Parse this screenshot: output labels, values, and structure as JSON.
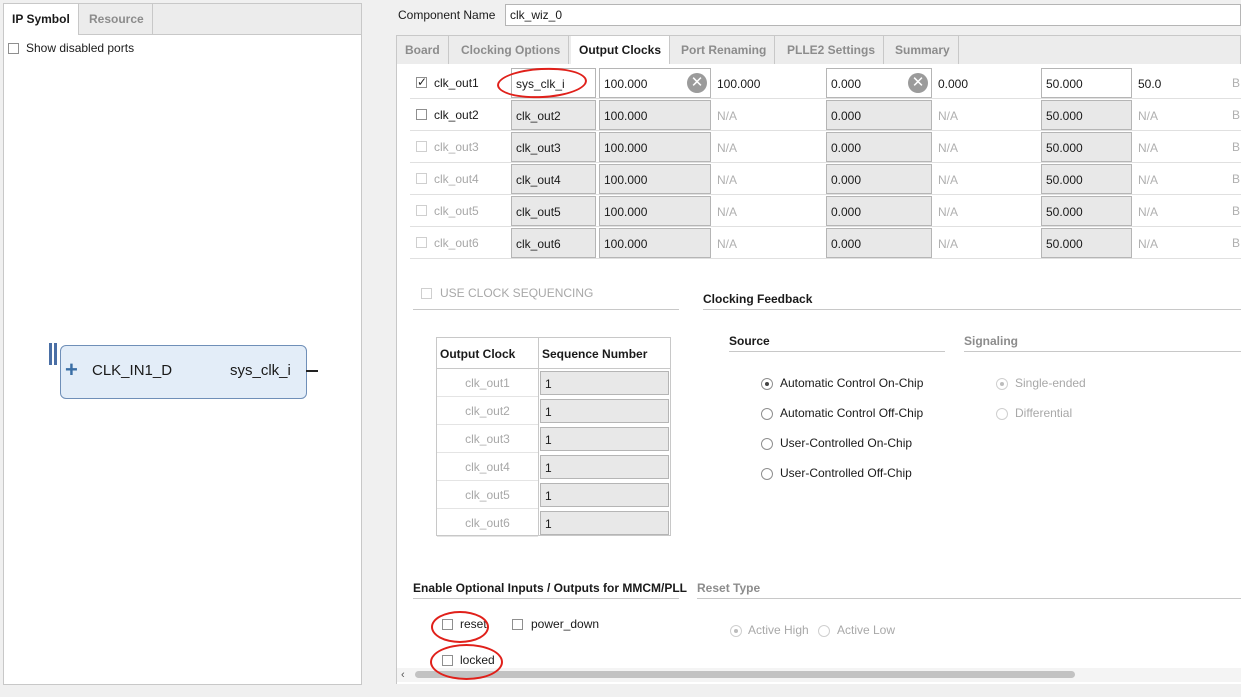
{
  "left_panel": {
    "tabs": [
      "IP Symbol",
      "Resource"
    ],
    "show_disabled_ports": "Show disabled ports",
    "symbol": {
      "input_port": "CLK_IN1_D",
      "output_port": "sys_clk_i"
    }
  },
  "component": {
    "label": "Component Name",
    "value": "clk_wiz_0"
  },
  "tabs": [
    "Board",
    "Clocking Options",
    "Output Clocks",
    "Port Renaming",
    "PLLE2 Settings",
    "Summary"
  ],
  "active_tab": "Output Clocks",
  "output_clocks": [
    {
      "name": "clk_out1",
      "port": "sys_clk_i",
      "freq": "100.000",
      "actual_freq": "100.000",
      "phase": "0.000",
      "actual_phase": "0.000",
      "duty": "50.000",
      "actual_duty": "50.0",
      "buffer": "B",
      "checked": true,
      "enabled": true
    },
    {
      "name": "clk_out2",
      "port": "clk_out2",
      "freq": "100.000",
      "actual_freq": "N/A",
      "phase": "0.000",
      "actual_phase": "N/A",
      "duty": "50.000",
      "actual_duty": "N/A",
      "buffer": "B",
      "checked": false,
      "enabled": true
    },
    {
      "name": "clk_out3",
      "port": "clk_out3",
      "freq": "100.000",
      "actual_freq": "N/A",
      "phase": "0.000",
      "actual_phase": "N/A",
      "duty": "50.000",
      "actual_duty": "N/A",
      "buffer": "B",
      "checked": false,
      "enabled": false
    },
    {
      "name": "clk_out4",
      "port": "clk_out4",
      "freq": "100.000",
      "actual_freq": "N/A",
      "phase": "0.000",
      "actual_phase": "N/A",
      "duty": "50.000",
      "actual_duty": "N/A",
      "buffer": "B",
      "checked": false,
      "enabled": false
    },
    {
      "name": "clk_out5",
      "port": "clk_out5",
      "freq": "100.000",
      "actual_freq": "N/A",
      "phase": "0.000",
      "actual_phase": "N/A",
      "duty": "50.000",
      "actual_duty": "N/A",
      "buffer": "B",
      "checked": false,
      "enabled": false
    },
    {
      "name": "clk_out6",
      "port": "clk_out6",
      "freq": "100.000",
      "actual_freq": "N/A",
      "phase": "0.000",
      "actual_phase": "N/A",
      "duty": "50.000",
      "actual_duty": "N/A",
      "buffer": "B",
      "checked": false,
      "enabled": false
    }
  ],
  "use_clock_sequencing": "USE CLOCK SEQUENCING",
  "sequence_table": {
    "headers": [
      "Output Clock",
      "Sequence Number"
    ],
    "rows": [
      {
        "clock": "clk_out1",
        "seq": "1"
      },
      {
        "clock": "clk_out2",
        "seq": "1"
      },
      {
        "clock": "clk_out3",
        "seq": "1"
      },
      {
        "clock": "clk_out4",
        "seq": "1"
      },
      {
        "clock": "clk_out5",
        "seq": "1"
      },
      {
        "clock": "clk_out6",
        "seq": "1"
      }
    ]
  },
  "feedback": {
    "title": "Clocking Feedback",
    "source_title": "Source",
    "signaling_title": "Signaling",
    "source_options": [
      "Automatic Control On-Chip",
      "Automatic Control Off-Chip",
      "User-Controlled On-Chip",
      "User-Controlled Off-Chip"
    ],
    "signaling_options": [
      "Single-ended",
      "Differential"
    ]
  },
  "optional_io": {
    "title": "Enable Optional Inputs / Outputs for MMCM/PLL",
    "reset": "reset",
    "power_down": "power_down",
    "locked": "locked"
  },
  "reset_type": {
    "title": "Reset Type",
    "active_high": "Active High",
    "active_low": "Active Low"
  },
  "colors": {
    "annotation": "#e0201a"
  }
}
